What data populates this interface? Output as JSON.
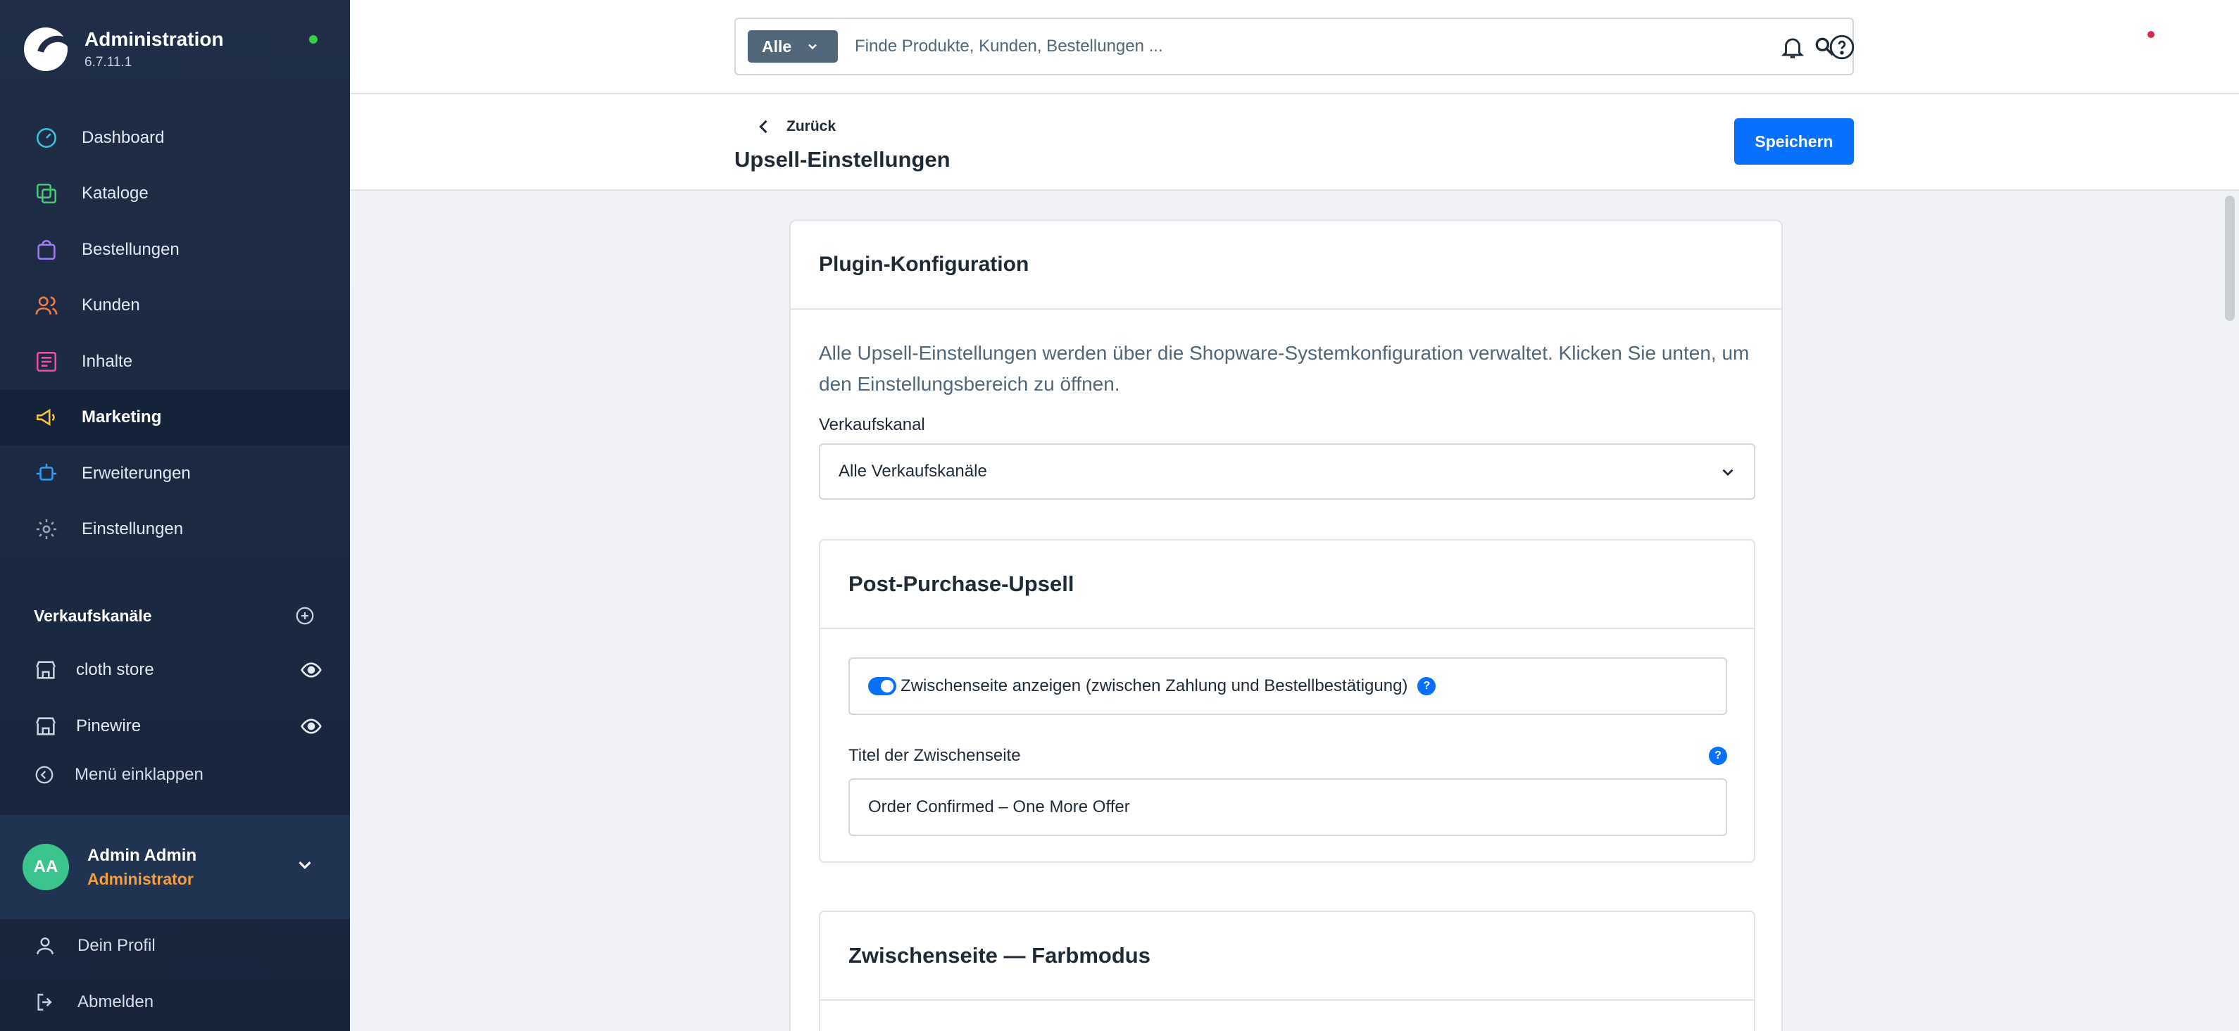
{
  "app": {
    "title": "Administration",
    "version": "6.7.11.1"
  },
  "nav": {
    "items": [
      {
        "label": "Dashboard",
        "icon": "dashboard-icon",
        "color": "#3fc1e0"
      },
      {
        "label": "Kataloge",
        "icon": "catalog-icon",
        "color": "#46c97a"
      },
      {
        "label": "Bestellungen",
        "icon": "orders-icon",
        "color": "#9e7cf5"
      },
      {
        "label": "Kunden",
        "icon": "customers-icon",
        "color": "#f47b46"
      },
      {
        "label": "Inhalte",
        "icon": "content-icon",
        "color": "#ef4fa0"
      },
      {
        "label": "Marketing",
        "icon": "marketing-icon",
        "color": "#f7c23e"
      },
      {
        "label": "Erweiterungen",
        "icon": "extensions-icon",
        "color": "#2f9ff5"
      },
      {
        "label": "Einstellungen",
        "icon": "settings-icon",
        "color": "#9aa6b6"
      }
    ],
    "active_index": 5
  },
  "sales_channels": {
    "heading": "Verkaufskanäle",
    "items": [
      {
        "label": "cloth store"
      },
      {
        "label": "Pinewire"
      }
    ],
    "collapse_label": "Menü einklappen"
  },
  "user": {
    "initials": "AA",
    "name": "Admin Admin",
    "role": "Administrator",
    "profile_label": "Dein Profil",
    "logout_label": "Abmelden"
  },
  "search": {
    "type_label": "Alle",
    "placeholder": "Finde Produkte, Kunden, Bestellungen ..."
  },
  "page": {
    "back_label": "Zurück",
    "title": "Upsell-Einstellungen",
    "save_label": "Speichern"
  },
  "plugin_card": {
    "title": "Plugin-Konfiguration",
    "description": "Alle Upsell-Einstellungen werden über die Shopware-Systemkonfiguration verwaltet. Klicken Sie unten, um den Einstellungsbereich zu öffnen.",
    "sales_channel_label": "Verkaufskanal",
    "sales_channel_value": "Alle Verkaufskanäle"
  },
  "post_purchase": {
    "title": "Post-Purchase-Upsell",
    "toggle_label": "Zwischenseite anzeigen (zwischen Zahlung und Bestellbestätigung)",
    "toggle_on": true,
    "page_title_label": "Titel der Zwischenseite",
    "page_title_value": "Order Confirmed – One More Offer"
  },
  "color_mode": {
    "title": "Zwischenseite — Farbmodus"
  },
  "colors": {
    "accent": "#0870ff",
    "sidebar_bg": "#1f2e46",
    "role": "#f59e3b",
    "status_online": "#37d046",
    "notification": "#de294c"
  }
}
